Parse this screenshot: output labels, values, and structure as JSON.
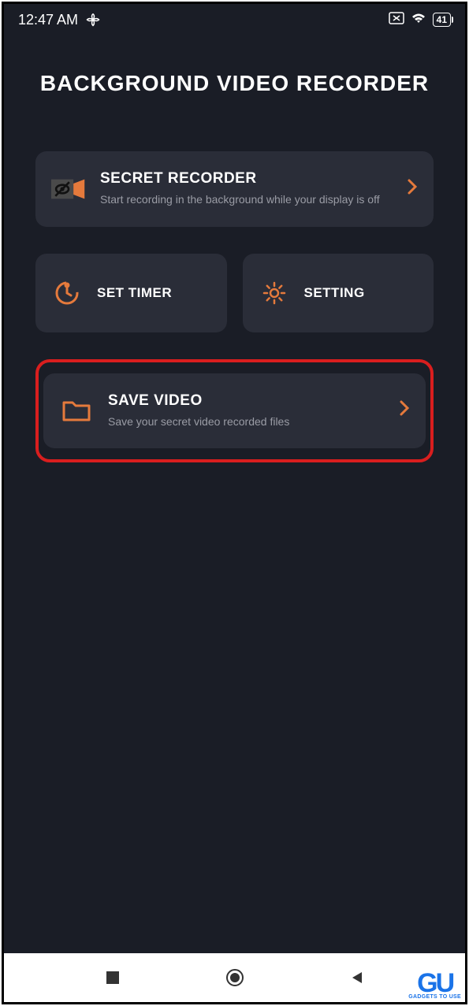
{
  "statusBar": {
    "time": "12:47 AM",
    "battery": "41"
  },
  "app": {
    "title": "BACKGROUND VIDEO RECORDER"
  },
  "cards": {
    "secretRecorder": {
      "title": "SECRET RECORDER",
      "subtitle": "Start recording in the background while your display is off"
    },
    "setTimer": {
      "title": "SET TIMER"
    },
    "setting": {
      "title": "SETTING"
    },
    "saveVideo": {
      "title": "SAVE VIDEO",
      "subtitle": "Save your secret video recorded files"
    }
  },
  "watermark": {
    "logo": "GU",
    "text": "GADGETS TO USE"
  }
}
